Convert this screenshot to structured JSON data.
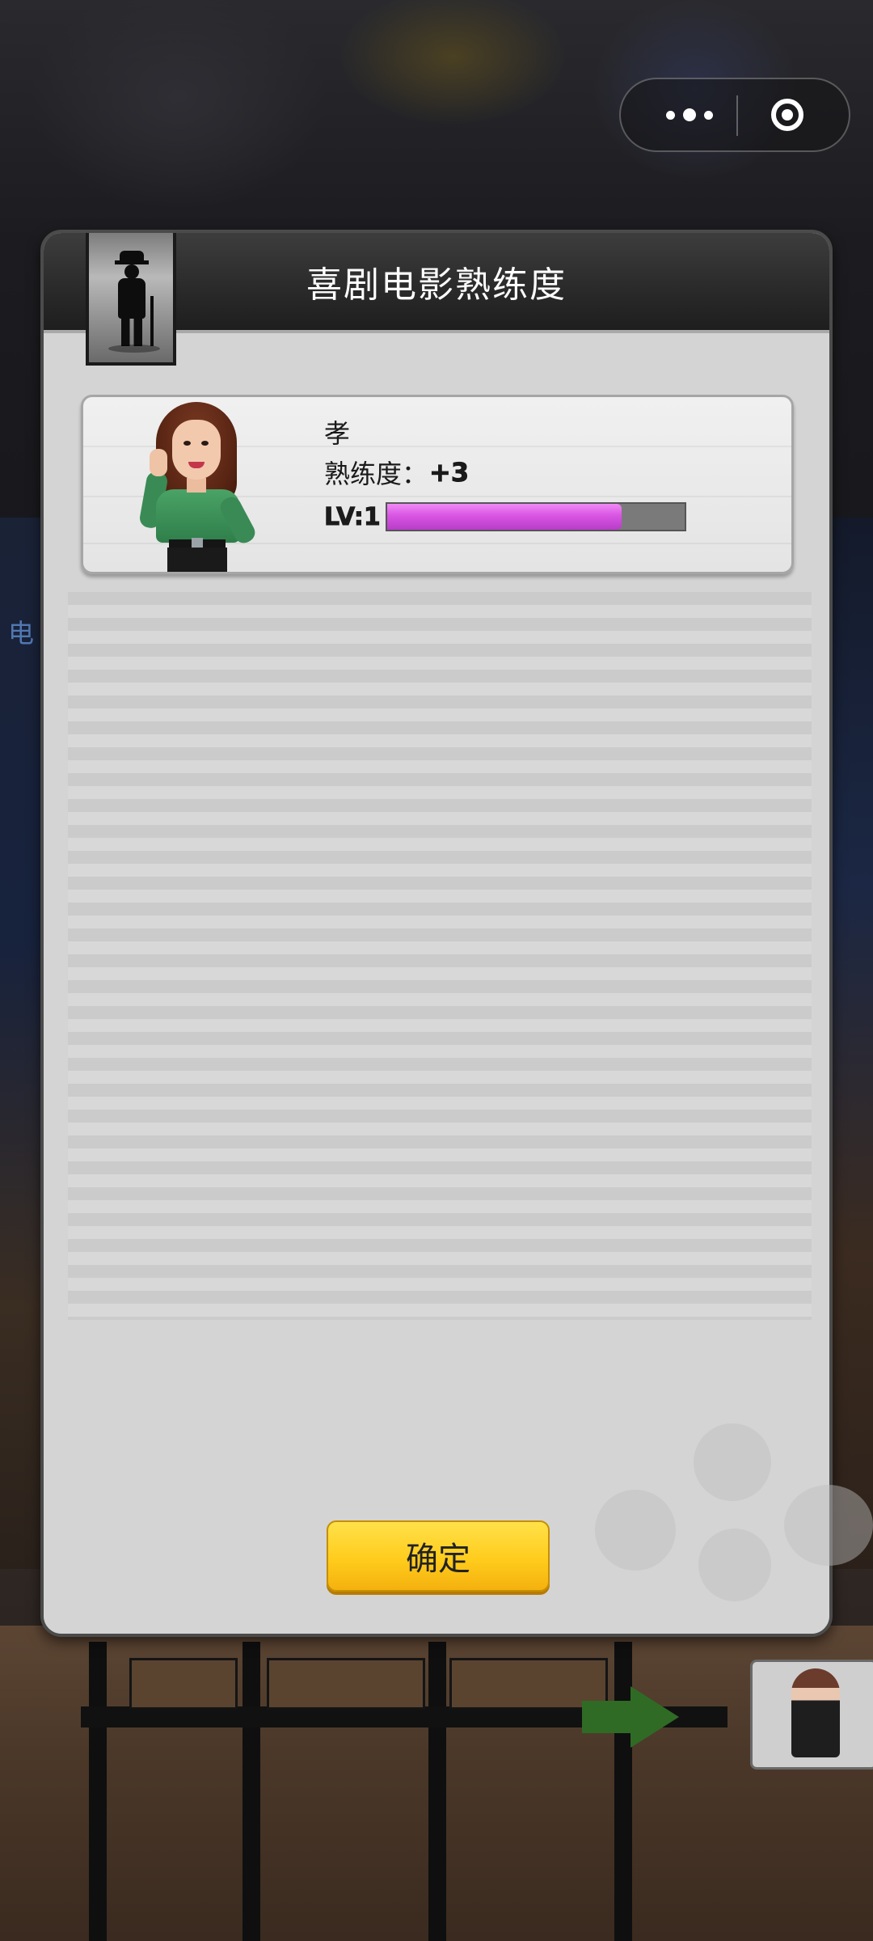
{
  "dialog": {
    "title": "喜剧电影熟练度",
    "genre_icon": "chaplin-silhouette-icon"
  },
  "actor": {
    "name": "孝",
    "proficiency_label": "熟练度：",
    "proficiency_delta": "+3",
    "level_label": "LV:1",
    "level_progress": 0.79,
    "level_bar_color": "#d955e3"
  },
  "buttons": {
    "confirm_label": "确定"
  },
  "background": {
    "left_edge_text": "电"
  },
  "capsule": {
    "more_icon": "more-dots-icon",
    "close_icon": "target-circle-icon"
  }
}
